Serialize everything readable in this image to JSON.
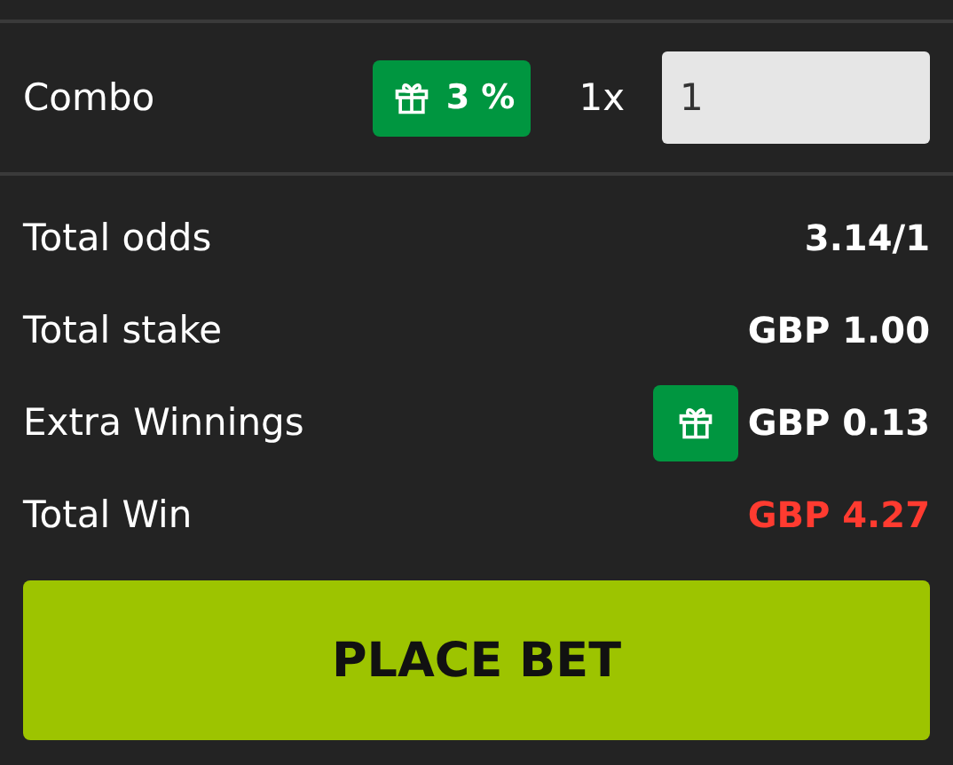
{
  "combo": {
    "label": "Combo",
    "bonus": "3 %",
    "multiplier": "1x",
    "stake": "1"
  },
  "summary": [
    {
      "label": "Total odds",
      "value": "3.14/1",
      "gift": false,
      "highlight": false
    },
    {
      "label": "Total stake",
      "value": "GBP 1.00",
      "gift": false,
      "highlight": false
    },
    {
      "label": "Extra Winnings",
      "value": "GBP 0.13",
      "gift": true,
      "highlight": false
    },
    {
      "label": "Total Win",
      "value": "GBP 4.27",
      "gift": false,
      "highlight": true
    }
  ],
  "button": "PLACE BET"
}
